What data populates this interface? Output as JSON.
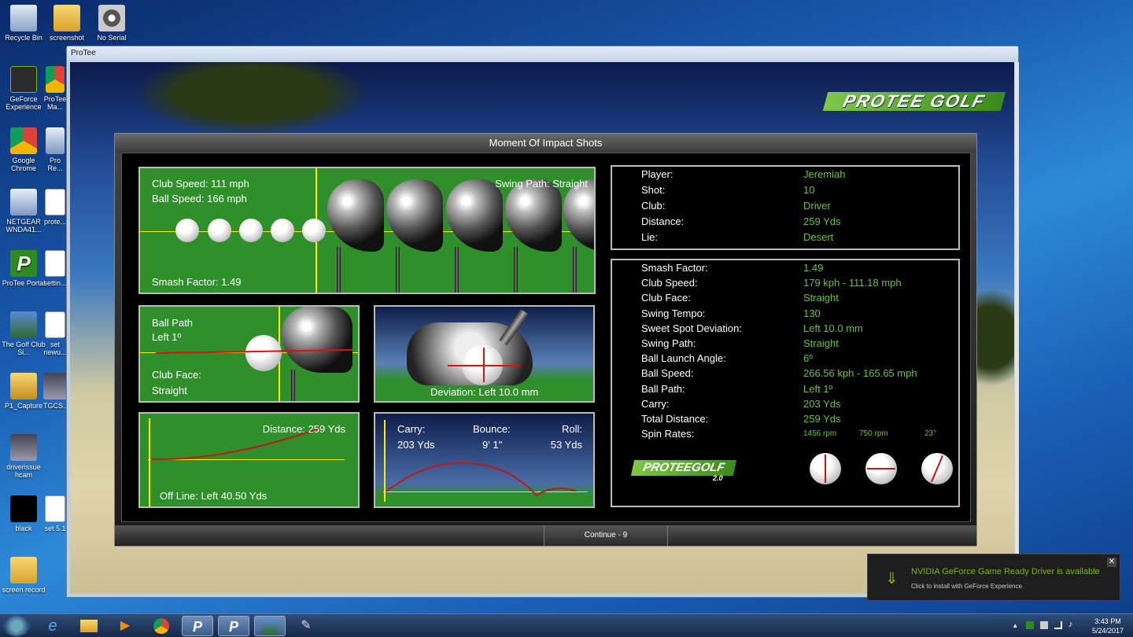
{
  "desktop": {
    "icons": [
      {
        "label": "Recycle Bin"
      },
      {
        "label": "screenshot"
      },
      {
        "label": "No Serial"
      },
      {
        "label": "GeForce Experience"
      },
      {
        "label": "ProTee Ma..."
      },
      {
        "label": "Google Chrome"
      },
      {
        "label": "Pro Re..."
      },
      {
        "label": "NETGEAR WNDA41..."
      },
      {
        "label": "prote..."
      },
      {
        "label": "ProTee Portal"
      },
      {
        "label": "settin..."
      },
      {
        "label": "The Golf Club Si..."
      },
      {
        "label": "set newu..."
      },
      {
        "label": "P1_Capture"
      },
      {
        "label": "TGCS..."
      },
      {
        "label": "driverissue hcam"
      },
      {
        "label": "black"
      },
      {
        "label": "set 5.1"
      },
      {
        "label": "screen record"
      }
    ]
  },
  "window": {
    "title": "ProTee",
    "logo": "PROTEE GOLF"
  },
  "panel": {
    "title": "Moment Of Impact Shots",
    "club_view": {
      "club_speed": "Club Speed:  111 mph",
      "ball_speed": "Ball Speed:  166 mph",
      "swing_path": "Swing Path:  Straight",
      "smash_factor": "Smash Factor:  1.49"
    },
    "path_view": {
      "ball_path_label": "Ball Path",
      "ball_path_value": "Left 1º",
      "club_face_label": "Club Face:",
      "club_face_value": "Straight"
    },
    "deviation_view": {
      "text": "Deviation:  Left 10.0 mm"
    },
    "distance_view": {
      "distance": "Distance:  259 Yds",
      "off_line": "Off Line:  Left 40.50 Yds"
    },
    "flight_view": {
      "carry_label": "Carry:",
      "carry_value": "203 Yds",
      "bounce_label": "Bounce:",
      "bounce_value": "9' 1\"",
      "roll_label": "Roll:",
      "roll_value": "53 Yds"
    },
    "player_info": [
      {
        "label": "Player:",
        "value": "Jeremiah"
      },
      {
        "label": "Shot:",
        "value": "10"
      },
      {
        "label": "Club:",
        "value": "Driver"
      },
      {
        "label": "Distance:",
        "value": "259 Yds"
      },
      {
        "label": "Lie:",
        "value": "Desert"
      }
    ],
    "stats": [
      {
        "label": "Smash Factor:",
        "value": "1.49"
      },
      {
        "label": "Club Speed:",
        "value": "179 kph - 111.18 mph"
      },
      {
        "label": "Club Face:",
        "value": "Straight"
      },
      {
        "label": "Swing Tempo:",
        "value": "130"
      },
      {
        "label": "Sweet Spot Deviation:",
        "value": "Left 10.0 mm"
      },
      {
        "label": "Swing Path:",
        "value": "Straight"
      },
      {
        "label": "Ball Launch Angle:",
        "value": "6º"
      },
      {
        "label": "Ball Speed:",
        "value": "266.56 kph - 165.65 mph"
      },
      {
        "label": "Ball Path:",
        "value": "Left 1º"
      },
      {
        "label": "Carry:",
        "value": "203 Yds"
      },
      {
        "label": "Total Distance:",
        "value": "259 Yds"
      },
      {
        "label": "Spin Rates:",
        "value": ""
      }
    ],
    "spin_rates": [
      "1456 rpm",
      "750 rpm",
      "23°"
    ],
    "stats_logo": "PROTEEGOLF",
    "stats_logo_sub": "2.0",
    "continue_label": "Continue - 9"
  },
  "notification": {
    "title": "NVIDIA GeForce Game Ready Driver is available",
    "subtitle": "Click to install with GeForce Experience."
  },
  "taskbar": {
    "time": "3:43 PM",
    "date": "5/24/2017"
  }
}
